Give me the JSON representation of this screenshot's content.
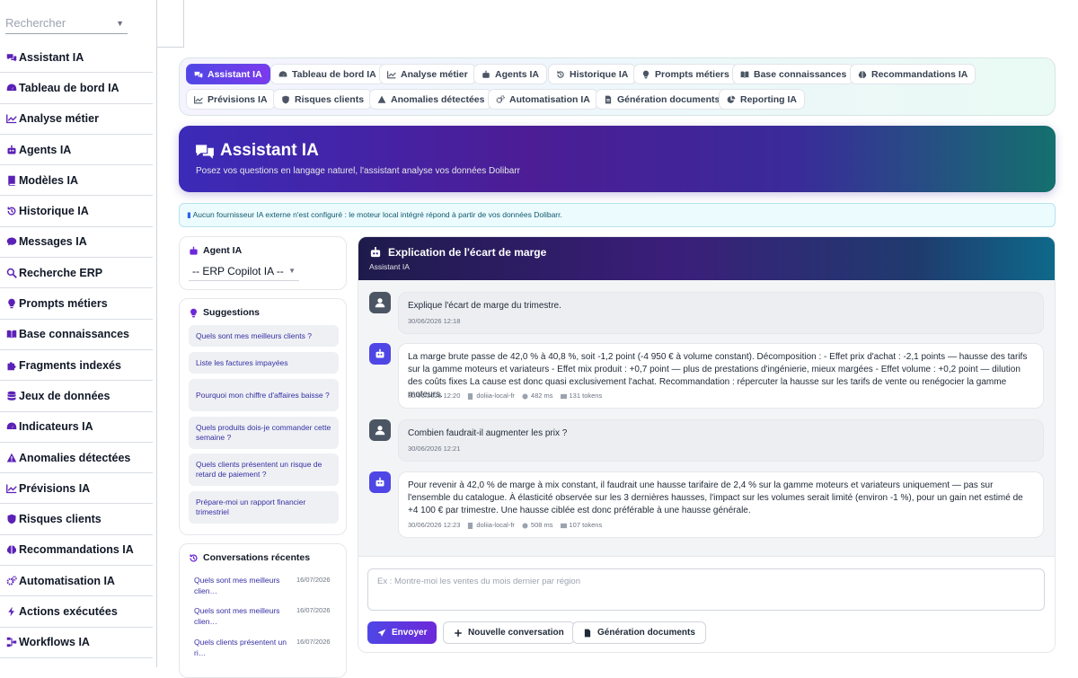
{
  "sidebar": {
    "search_placeholder": "Rechercher",
    "items": [
      {
        "label": "Assistant IA",
        "icon": "chat-bubbles-icon"
      },
      {
        "label": "Tableau de bord IA",
        "icon": "dashboard-icon"
      },
      {
        "label": "Analyse métier",
        "icon": "line-chart-icon"
      },
      {
        "label": "Agents IA",
        "icon": "robot-icon"
      },
      {
        "label": "Modèles IA",
        "icon": "book-icon"
      },
      {
        "label": "Historique IA",
        "icon": "history-icon"
      },
      {
        "label": "Messages IA",
        "icon": "chat-icon"
      },
      {
        "label": "Recherche ERP",
        "icon": "search-icon"
      },
      {
        "label": "Prompts métiers",
        "icon": "lightbulb-icon"
      },
      {
        "label": "Base connaissances",
        "icon": "open-book-icon"
      },
      {
        "label": "Fragments indexés",
        "icon": "puzzle-icon"
      },
      {
        "label": "Jeux de données",
        "icon": "database-icon"
      },
      {
        "label": "Indicateurs IA",
        "icon": "gauge-icon"
      },
      {
        "label": "Anomalies détectées",
        "icon": "warning-icon"
      },
      {
        "label": "Prévisions IA",
        "icon": "trend-chart-icon"
      },
      {
        "label": "Risques clients",
        "icon": "shield-icon"
      },
      {
        "label": "Recommandations IA",
        "icon": "brain-icon"
      },
      {
        "label": "Automatisation IA",
        "icon": "gears-icon"
      },
      {
        "label": "Actions exécutées",
        "icon": "bolt-icon"
      },
      {
        "label": "Workflows IA",
        "icon": "workflow-icon"
      }
    ]
  },
  "tabs": [
    {
      "label": "Assistant IA",
      "icon": "chat-bubbles-icon",
      "active": true
    },
    {
      "label": "Tableau de bord IA",
      "icon": "dashboard-icon"
    },
    {
      "label": "Analyse métier",
      "icon": "line-chart-icon"
    },
    {
      "label": "Agents IA",
      "icon": "robot-icon"
    },
    {
      "label": "Historique IA",
      "icon": "history-icon"
    },
    {
      "label": "Prompts métiers",
      "icon": "lightbulb-icon"
    },
    {
      "label": "Base connaissances",
      "icon": "open-book-icon"
    },
    {
      "label": "Recommandations IA",
      "icon": "brain-icon"
    },
    {
      "label": "Prévisions IA",
      "icon": "trend-chart-icon"
    },
    {
      "label": "Risques clients",
      "icon": "shield-icon"
    },
    {
      "label": "Anomalies détectées",
      "icon": "warning-icon"
    },
    {
      "label": "Automatisation IA",
      "icon": "gears-icon"
    },
    {
      "label": "Génération documents",
      "icon": "document-icon"
    },
    {
      "label": "Reporting IA",
      "icon": "pie-chart-icon"
    }
  ],
  "hero": {
    "title": "Assistant IA",
    "subtitle": "Posez vos questions en langage naturel, l'assistant analyse vos données Dolibarr"
  },
  "notice": "Aucun fournisseur IA externe n'est configuré : le moteur local intégré répond à partir de vos données Dolibarr.",
  "agent_panel": {
    "title": "Agent IA",
    "selected": "-- ERP Copilot IA --"
  },
  "suggestions": {
    "title": "Suggestions",
    "items": [
      "Quels sont mes meilleurs clients ?",
      "Liste les factures impayées",
      "Pourquoi mon chiffre d'affaires baisse ?",
      "Quels produits dois-je commander cette semaine ?",
      "Quels clients présentent un risque de retard de paiement ?",
      "Prépare-moi un rapport financier trimestriel"
    ]
  },
  "recent": {
    "title": "Conversations récentes",
    "items": [
      {
        "text": "Quels sont mes meilleurs clien…",
        "date": "16/07/2026"
      },
      {
        "text": "Quels sont mes meilleurs clien…",
        "date": "16/07/2026"
      },
      {
        "text": "Quels clients présentent un ri…",
        "date": "16/07/2026"
      }
    ]
  },
  "chat": {
    "title": "Explication de l'écart de marge",
    "subtitle": "Assistant IA",
    "messages": [
      {
        "role": "user",
        "text": "Explique l'écart de marge du trimestre.",
        "time": "30/06/2026 12:18"
      },
      {
        "role": "bot",
        "text": "La marge brute passe de 42,0 % à 40,8 %, soit -1,2 point (-4 950 € à volume constant). Décomposition : - Effet prix d'achat : -2,1 points — hausse des tarifs sur la gamme moteurs et variateurs - Effet mix produit : +0,7 point — plus de prestations d'ingénierie, mieux margées - Effet volume : +0,2 point — dilution des coûts fixes La cause est donc quasi exclusivement l'achat. Recommandation : répercuter la hausse sur les tarifs de vente ou renégocier la gamme moteurs.",
        "time": "30/06/2026 12:20",
        "engine": "doliia-local-fr",
        "duration": "482 ms",
        "tokens": "131 tokens"
      },
      {
        "role": "user",
        "text": "Combien faudrait-il augmenter les prix ?",
        "time": "30/06/2026 12:21"
      },
      {
        "role": "bot",
        "text": "Pour revenir à 42,0 % de marge à mix constant, il faudrait une hausse tarifaire de 2,4 % sur la gamme moteurs et variateurs uniquement — pas sur l'ensemble du catalogue. À élasticité observée sur les 3 dernières hausses, l'impact sur les volumes serait limité (environ -1 %), pour un gain net estimé de +4 100 € par trimestre. Une hausse ciblée est donc préférable à une hausse générale.",
        "time": "30/06/2026 12:23",
        "engine": "doliia-local-fr",
        "duration": "508 ms",
        "tokens": "107 tokens"
      }
    ],
    "input_placeholder": "Ex : Montre-moi les ventes du mois dernier par région",
    "send_label": "Envoyer",
    "new_conv_label": "Nouvelle conversation",
    "gen_docs_label": "Génération documents"
  },
  "colors": {
    "accent": "#4f46e5",
    "accent2": "#6d28d9",
    "teal": "#14706e",
    "link": "#3730a3"
  }
}
